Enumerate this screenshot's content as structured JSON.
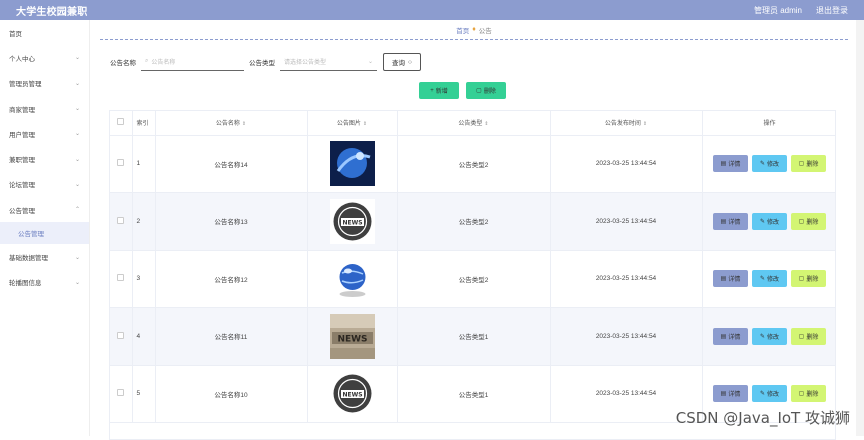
{
  "header": {
    "title": "大学生校园兼职",
    "user": "管理员 admin",
    "logout": "退出登录"
  },
  "sidebar": {
    "items": [
      {
        "label": "首页",
        "has_children": false
      },
      {
        "label": "个人中心",
        "has_children": true
      },
      {
        "label": "管理员管理",
        "has_children": true
      },
      {
        "label": "商家管理",
        "has_children": true
      },
      {
        "label": "用户管理",
        "has_children": true
      },
      {
        "label": "兼职管理",
        "has_children": true
      },
      {
        "label": "论坛管理",
        "has_children": true
      },
      {
        "label": "公告管理",
        "has_children": true
      }
    ],
    "active_sub": "公告管理",
    "items_after": [
      {
        "label": "基础数据管理",
        "has_children": true
      },
      {
        "label": "轮播图信息",
        "has_children": true
      }
    ]
  },
  "breadcrumb": {
    "home": "首页",
    "current": "公告"
  },
  "search": {
    "name_label": "公告名称",
    "name_placeholder": "公告名称",
    "type_label": "公告类型",
    "type_placeholder": "请选择公告类型",
    "query_button": "查询"
  },
  "actions": {
    "add": "新增",
    "delete": "删除"
  },
  "table": {
    "headers": {
      "index": "索引",
      "name": "公告名称",
      "image": "公告图片",
      "type": "公告类型",
      "time": "公告发布时间",
      "ops": "操作"
    },
    "rows": [
      {
        "index": "1",
        "name": "公告名称14",
        "image": "blue-globe-image",
        "type": "公告类型2",
        "time": "2023-03-25 13:44:54"
      },
      {
        "index": "2",
        "name": "公告名称13",
        "image": "news-circle-image",
        "type": "公告类型2",
        "time": "2023-03-25 13:44:54"
      },
      {
        "index": "3",
        "name": "公告名称12",
        "image": "globe-icon-image",
        "type": "公告类型2",
        "time": "2023-03-25 13:44:54"
      },
      {
        "index": "4",
        "name": "公告名称11",
        "image": "newspaper-image",
        "type": "公告类型1",
        "time": "2023-03-25 13:44:54"
      },
      {
        "index": "5",
        "name": "公告名称10",
        "image": "news-circle-image",
        "type": "公告类型1",
        "time": "2023-03-25 13:44:54"
      }
    ],
    "row_ops": {
      "detail": "详情",
      "edit": "修改",
      "remove": "删除"
    }
  },
  "watermark": "CSDN @Java_IoT 攻诚狮",
  "colors": {
    "header": "#8c9ccf",
    "add": "#34d095",
    "detail": "#8c9ccf",
    "edit": "#5fc8f2",
    "remove": "#d3f573"
  }
}
